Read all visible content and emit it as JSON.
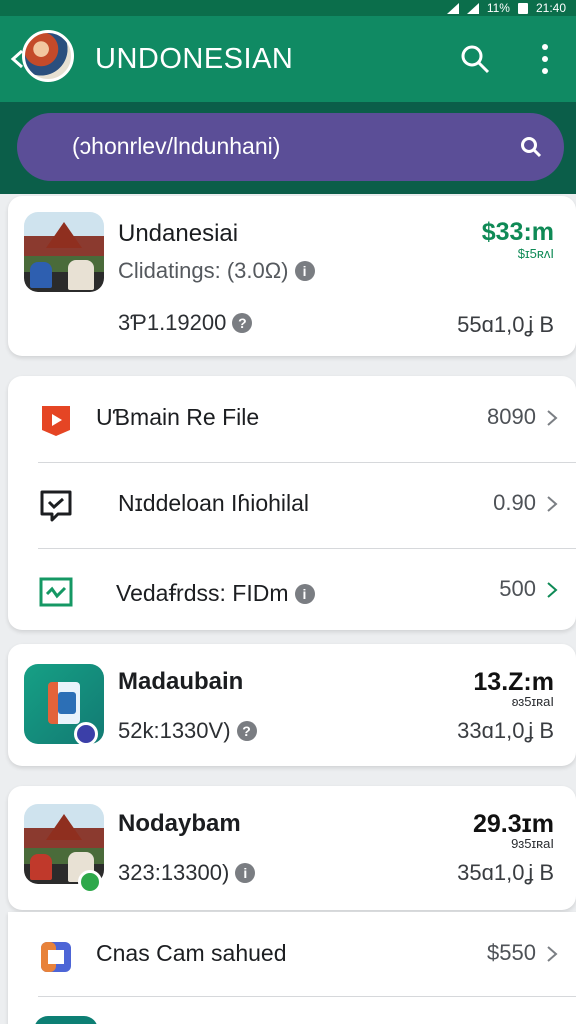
{
  "status": {
    "battery": "11%",
    "time": "21:40"
  },
  "header": {
    "title": "UNDONESIAN",
    "back_icon": "back-arrow-icon",
    "search_icon": "search-icon",
    "more_icon": "more-vert-icon"
  },
  "search": {
    "query": "(ɔhonrlev/lndunhani)"
  },
  "colors": {
    "appbar": "#108a63",
    "search_bg": "#5b4e97",
    "accent_green": "#0f8a56"
  },
  "card1": {
    "name": "Undanesiai",
    "rating_label": "Clidatings: (3.0Ω)",
    "price": "$33:m",
    "price_sub": "$ɪ5ʀʌI",
    "stat_left": "3Ƥ1.19200",
    "stat_right": "55ɑ1,0ʝ B"
  },
  "menu": {
    "items": [
      {
        "label": "UƁmain Re File",
        "value": "8090",
        "icon": "play-icon"
      },
      {
        "label": "Nɪddeloan Iɦiohilal",
        "value": "0.90",
        "icon": "message-check-icon"
      },
      {
        "label": "Vedaꞙrdss: FIDm",
        "value": "500",
        "icon": "spreadsheet-icon"
      }
    ]
  },
  "card2": {
    "name": "Madaubain",
    "stat": "52k:1330V)",
    "price": "13.Z:m",
    "price_sub": "ʚɜ5ɪʀaI",
    "stat_right": "33ɑ1,0ʝ B"
  },
  "card3": {
    "name": "Nodaybam",
    "stat": "323:13300)",
    "price": "29.3ɪm",
    "price_sub": "9ɜ5ɪʀaI",
    "stat_right": "35ɑ1,0ʝ B"
  },
  "bottom_row": {
    "label": "Cnas Cam sahued",
    "value": "$550",
    "icon": "calendar-app-icon"
  }
}
